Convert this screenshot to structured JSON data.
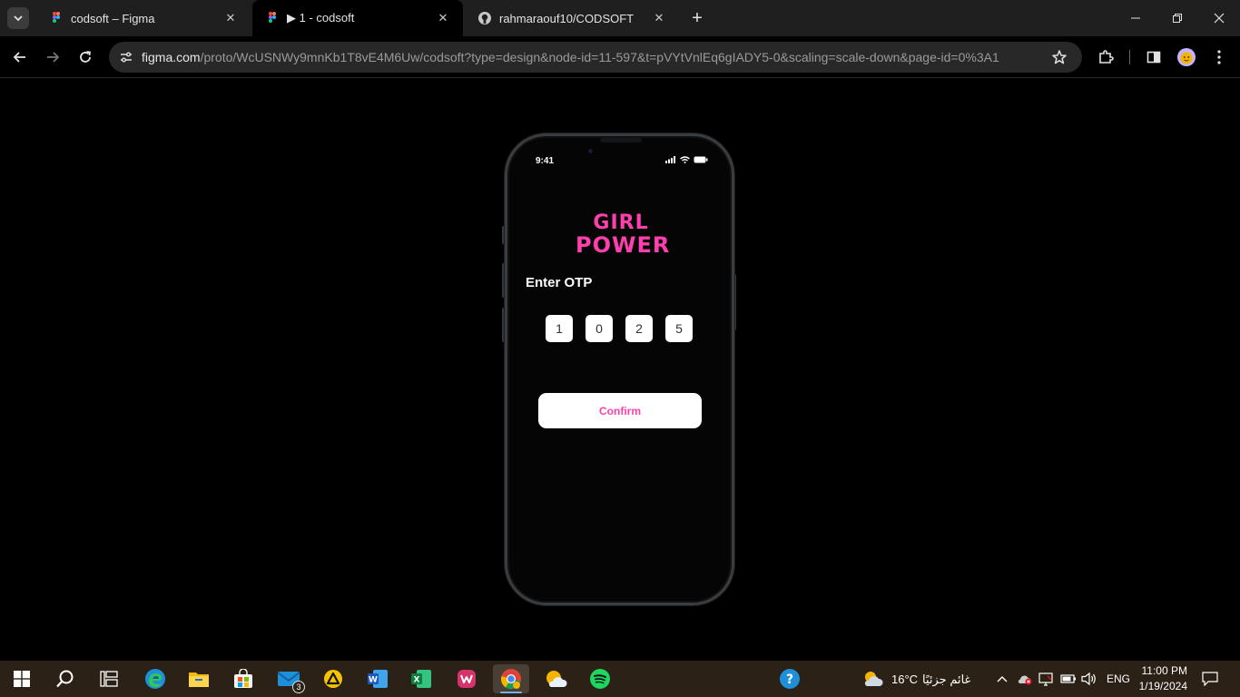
{
  "browser": {
    "tabs": [
      {
        "title": "codsoft – Figma",
        "icon": "figma-icon",
        "active": false
      },
      {
        "title": "▶ 1 - codsoft",
        "icon": "figma-icon",
        "active": true
      },
      {
        "title": "rahmaraouf10/CODSOFT",
        "icon": "github-icon",
        "active": false
      }
    ],
    "url_host": "figma.com",
    "url_path": "/proto/WcUSNWy9mnKb1T8vE4M6Uw/codsoft?type=design&node-id=11-597&t=pVYtVnlEq6gIADY5-0&scaling=scale-down&page-id=0%3A1"
  },
  "phone": {
    "status_time": "9:41",
    "logo_line1": "GIRL",
    "logo_line2": "POWER",
    "otp_title": "Enter OTP",
    "otp_digits": [
      "1",
      "0",
      "2",
      "5"
    ],
    "confirm_label": "Confirm",
    "accent_color": "#ff3fae"
  },
  "taskbar": {
    "mail_badge": "3",
    "weather_temp": "16°C",
    "weather_text": "غائم جزئيًا",
    "language": "ENG",
    "time": "11:00 PM",
    "date": "1/19/2024"
  }
}
